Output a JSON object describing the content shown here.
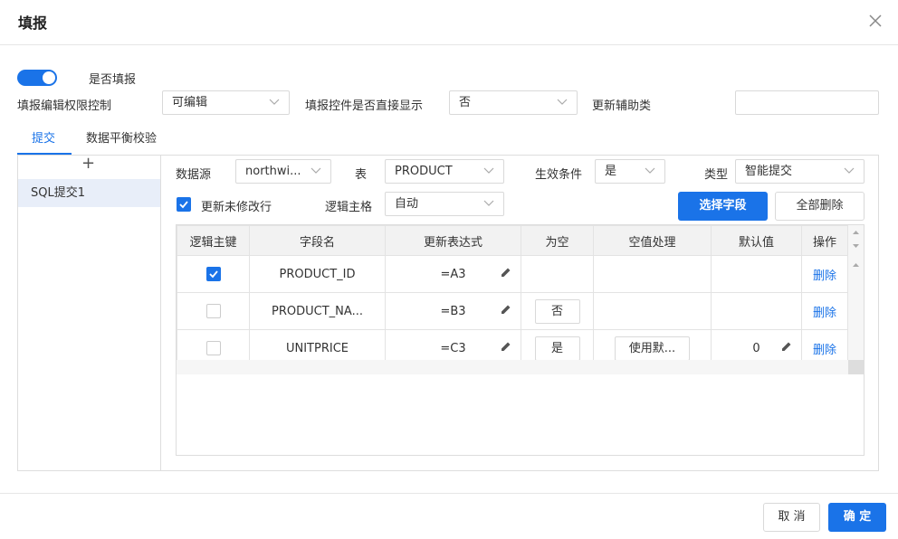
{
  "dialog": {
    "title": "填报"
  },
  "toggle": {
    "label": "是否填报",
    "on": true
  },
  "settings": {
    "permission_label": "填报编辑权限控制",
    "permission_value": "可编辑",
    "direct_show_label": "填报控件是否直接显示",
    "direct_show_value": "否",
    "helper_label": "更新辅助类",
    "helper_value": ""
  },
  "tabs": [
    {
      "label": "提交",
      "active": true
    },
    {
      "label": "数据平衡校验",
      "active": false
    }
  ],
  "left_panel": {
    "add_symbol": "+",
    "items": [
      "SQL提交1"
    ]
  },
  "config": {
    "datasource_label": "数据源",
    "datasource_value": "northwi...",
    "table_label": "表",
    "table_value": "PRODUCT",
    "condition_label": "生效条件",
    "condition_value": "是",
    "type_label": "类型",
    "type_value": "智能提交",
    "update_unmodified_label": "更新未修改行",
    "update_unmodified_checked": true,
    "logic_pk_label": "逻辑主格",
    "logic_pk_value": "自动",
    "select_fields_button": "选择字段",
    "delete_all_button": "全部删除"
  },
  "grid": {
    "headers": [
      "逻辑主键",
      "字段名",
      "更新表达式",
      "为空",
      "空值处理",
      "默认值",
      "操作"
    ],
    "rows": [
      {
        "pk": true,
        "field": "PRODUCT_ID",
        "expr": "=A3",
        "nullable": "",
        "null_handling": "",
        "default": "",
        "action": "删除"
      },
      {
        "pk": false,
        "field": "PRODUCT_NA...",
        "expr": "=B3",
        "nullable": "否",
        "null_handling": "",
        "default": "",
        "action": "删除"
      },
      {
        "pk": false,
        "field": "UNITPRICE",
        "expr": "=C3",
        "nullable": "是",
        "null_handling": "使用默...",
        "default": "0",
        "action": "删除"
      }
    ]
  },
  "footer": {
    "cancel": "取 消",
    "confirm": "确 定"
  },
  "colors": {
    "accent": "#1a73e8",
    "border": "#d9d9d9",
    "header_bg": "#f2f2f2",
    "selected_bg": "#e8eef9"
  }
}
